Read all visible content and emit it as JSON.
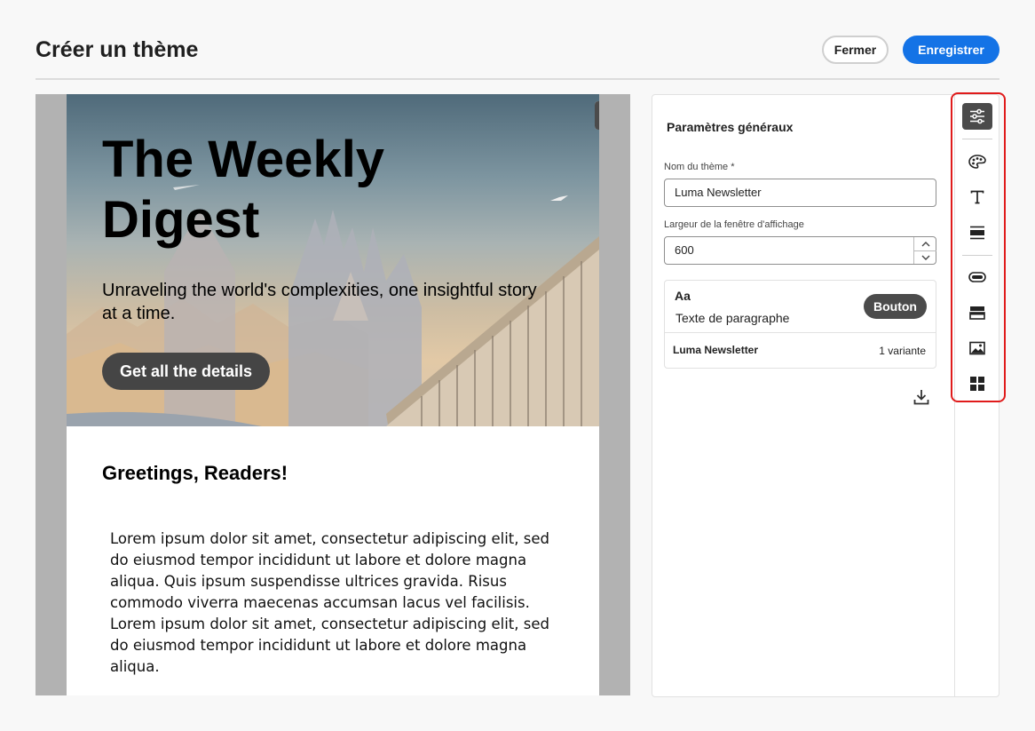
{
  "header": {
    "title": "Créer un thème",
    "close_label": "Fermer",
    "save_label": "Enregistrer"
  },
  "preview": {
    "view_modes": [
      "desktop-icon",
      "mobile-icon"
    ],
    "active_view": "desktop",
    "hero": {
      "title": "The Weekly Digest",
      "subtitle": "Unraveling the world's complexities, one insightful story at a time.",
      "cta_label": "Get all the details"
    },
    "greeting": "Greetings, Readers!",
    "body_text": "Lorem ipsum dolor sit amet, consectetur adipiscing elit, sed do eiusmod tempor incididunt ut labore et dolore magna aliqua. Quis ipsum suspendisse ultrices gravida. Risus commodo viverra maecenas accumsan lacus vel facilisis. Lorem ipsum dolor sit amet, consectetur adipiscing elit, sed do eiusmod tempor incididunt ut labore et dolore magna aliqua."
  },
  "panel": {
    "title": "Paramètres généraux",
    "theme_name_label": "Nom du thème",
    "required_marker": "*",
    "theme_name_value": "Luma Newsletter",
    "viewport_label": "Largeur de la fenêtre d'affichage",
    "viewport_value": "600",
    "card": {
      "sample_heading": "Aa",
      "sample_paragraph": "Texte de paragraphe",
      "sample_button": "Bouton",
      "theme_name": "Luma Newsletter",
      "variant_count": "1 variante"
    }
  },
  "rail": {
    "items": [
      "general-settings-icon",
      "palette-icon",
      "text-icon",
      "divider-block-icon",
      "button-icon",
      "container-icon",
      "image-icon",
      "grid-icon"
    ],
    "active": "general-settings-icon"
  },
  "colors": {
    "accent": "#1473e6",
    "highlight": "#e01b1b",
    "dark_button": "#4b4b4b"
  }
}
